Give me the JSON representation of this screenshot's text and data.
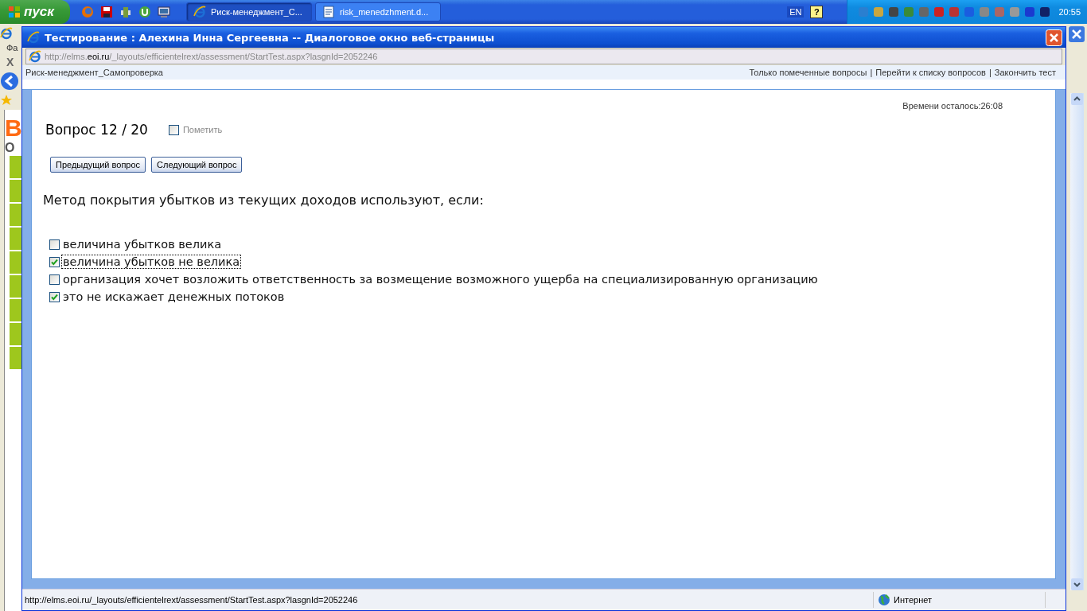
{
  "taskbar": {
    "start_label": "пуск",
    "tasks": [
      {
        "label": "Риск-менеджмент_С...",
        "kind": "browser",
        "selected": true
      },
      {
        "label": "risk_menedzhment.d...",
        "kind": "document",
        "selected": false
      }
    ],
    "language": "EN",
    "help_glyph": "?",
    "clock": "20:55"
  },
  "background_window": {
    "menu_fragment": "Фа",
    "close_glyph": "X",
    "logo_fragments": [
      "В",
      "О"
    ]
  },
  "dialog": {
    "title": "Тестирование : Алехина Инна Сергеевна -- Диалоговое окно веб-страницы",
    "address": [
      {
        "text": "http://elms.",
        "emphasis": false
      },
      {
        "text": "eoi.ru",
        "emphasis": true
      },
      {
        "text": "/_layouts/efficientelrext/assessment/StartTest.aspx?lasgnId=2052246",
        "emphasis": false
      }
    ],
    "course_title": "Риск-менеджмент_Самопроверка",
    "nav_links": [
      "Только помеченные вопросы",
      "Перейти к списку вопросов",
      "Закончить тест"
    ],
    "separator": "|",
    "timer": "Времени осталось:26:08",
    "question_number": "Вопрос 12 / 20",
    "flag": {
      "label": "Пометить",
      "checked": false
    },
    "buttons": [
      "Предыдущий вопрос",
      "Следующий вопрос"
    ],
    "question": "Метод покрытия убытков из текущих доходов используют, если:",
    "answers": [
      {
        "text": "величина убытков велика",
        "checked": false,
        "focused": false
      },
      {
        "text": "величина убытков не велика",
        "checked": true,
        "focused": true
      },
      {
        "text": "организация хочет возложить ответственность за возмещение возможного ущерба на специализированную организацию",
        "checked": false,
        "focused": false
      },
      {
        "text": "это не искажает денежных потоков",
        "checked": true,
        "focused": false
      }
    ]
  },
  "status_bar": {
    "url": "http://elms.eoi.ru/_layouts/efficientelrext/assessment/StartTest.aspx?lasgnId=2052246",
    "zone": "Интернет"
  }
}
